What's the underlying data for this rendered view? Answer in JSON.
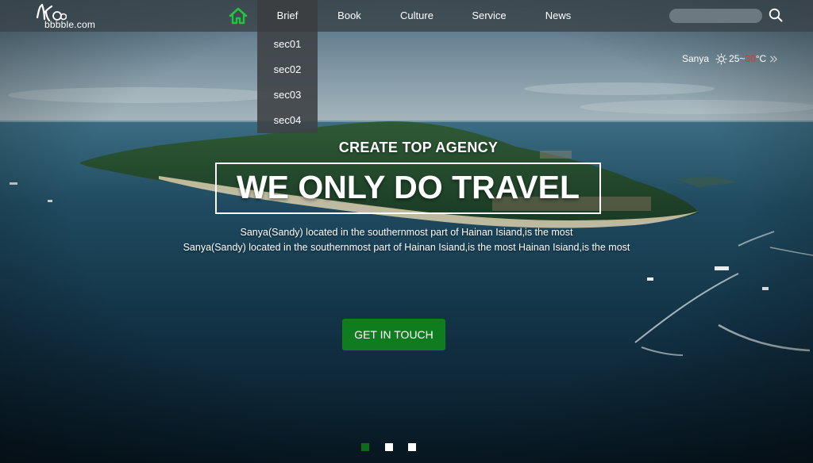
{
  "brand": {
    "logo_text": "bbbble.com",
    "logo_icon": "figure-logo-icon"
  },
  "nav": {
    "home_icon": "home-icon",
    "items": [
      {
        "label": "Brief",
        "active": true
      },
      {
        "label": "Book"
      },
      {
        "label": "Culture"
      },
      {
        "label": "Service"
      },
      {
        "label": "News"
      }
    ],
    "dropdown": [
      "sec01",
      "sec02",
      "sec03",
      "sec04"
    ]
  },
  "search": {
    "placeholder": "",
    "icon": "search-icon"
  },
  "weather": {
    "city": "Sanya",
    "icon": "sun-icon",
    "temp_low": "25~",
    "temp_high": "30",
    "unit": "°C",
    "more_icon": "double-chevron-right-icon"
  },
  "hero": {
    "subtitle": "CREATE TOP AGENCY",
    "title": "WE ONLY DO TRAVEL",
    "line1": "Sanya(Sandy) located in the southernmost part of Hainan Isiand,is the most",
    "line2": "Sanya(Sandy) located in the southernmost part of Hainan Isiand,is the most Hainan Isiand,is the most",
    "cta": "GET IN TOUCH"
  },
  "slider": {
    "count": 3,
    "active_index": 0
  },
  "colors": {
    "accent_green": "#0f7c1f",
    "home_icon_green": "#22c53a",
    "temp_high_red": "#e0332c",
    "navbar": "#3a444a"
  }
}
